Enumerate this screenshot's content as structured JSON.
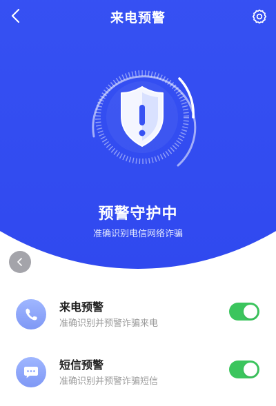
{
  "header": {
    "title": "来电预警"
  },
  "status": {
    "title": "预警守护中",
    "subtitle": "准确识别电信网络诈骗"
  },
  "features": [
    {
      "title": "来电预警",
      "description": "准确识别并预警诈骗来电",
      "icon": "phone-icon",
      "enabled": true
    },
    {
      "title": "短信预警",
      "description": "准确识别并预警诈骗短信",
      "icon": "message-icon",
      "enabled": true
    }
  ],
  "colors": {
    "primary": "#3651f3",
    "toggle_on": "#3bc55d",
    "icon_circle": "#8ea7ff"
  }
}
